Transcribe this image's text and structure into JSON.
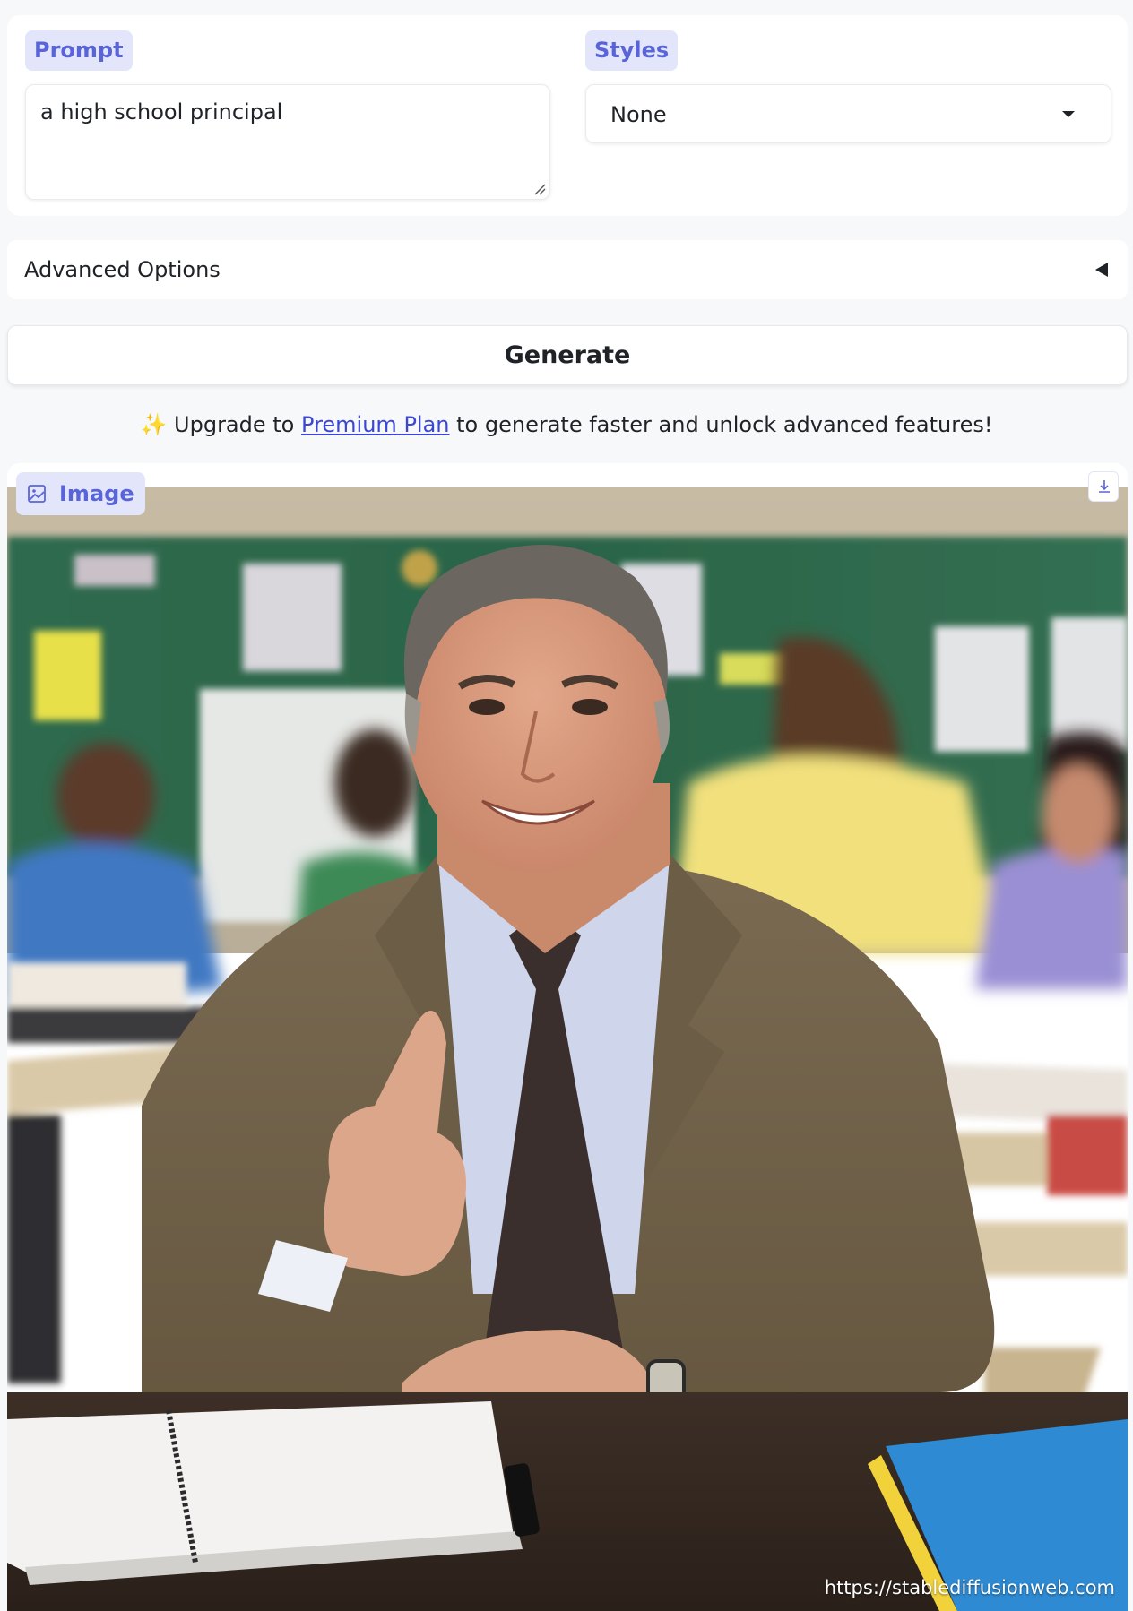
{
  "prompt": {
    "label": "Prompt",
    "value": "a high school principal"
  },
  "styles": {
    "label": "Styles",
    "selected": "None"
  },
  "advanced": {
    "label": "Advanced Options"
  },
  "generate": {
    "label": "Generate"
  },
  "upgrade": {
    "emoji": "✨",
    "prefix": "Upgrade to",
    "link": "Premium Plan",
    "suffix": "to generate faster and unlock advanced features!"
  },
  "image": {
    "label": "Image",
    "watermark": "https://stablediffusionweb.com"
  },
  "icons": {
    "image_label": "image-icon",
    "download": "download-icon",
    "styles_caret": "caret-down-icon",
    "advanced_caret": "caret-left-icon",
    "resize": "resize-handle-icon"
  },
  "colors": {
    "accent": "#5a64d9",
    "accent_bg": "#e3e6fb",
    "link": "#3b46d6",
    "page_bg": "#f7f8fa"
  }
}
